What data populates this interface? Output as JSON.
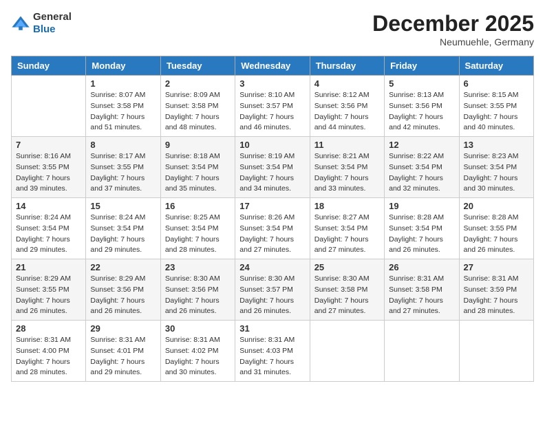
{
  "logo": {
    "general": "General",
    "blue": "Blue"
  },
  "header": {
    "month": "December 2025",
    "location": "Neumuehle, Germany"
  },
  "weekdays": [
    "Sunday",
    "Monday",
    "Tuesday",
    "Wednesday",
    "Thursday",
    "Friday",
    "Saturday"
  ],
  "weeks": [
    [
      {
        "day": "",
        "sunrise": "",
        "sunset": "",
        "daylight": ""
      },
      {
        "day": "1",
        "sunrise": "Sunrise: 8:07 AM",
        "sunset": "Sunset: 3:58 PM",
        "daylight": "Daylight: 7 hours and 51 minutes."
      },
      {
        "day": "2",
        "sunrise": "Sunrise: 8:09 AM",
        "sunset": "Sunset: 3:58 PM",
        "daylight": "Daylight: 7 hours and 48 minutes."
      },
      {
        "day": "3",
        "sunrise": "Sunrise: 8:10 AM",
        "sunset": "Sunset: 3:57 PM",
        "daylight": "Daylight: 7 hours and 46 minutes."
      },
      {
        "day": "4",
        "sunrise": "Sunrise: 8:12 AM",
        "sunset": "Sunset: 3:56 PM",
        "daylight": "Daylight: 7 hours and 44 minutes."
      },
      {
        "day": "5",
        "sunrise": "Sunrise: 8:13 AM",
        "sunset": "Sunset: 3:56 PM",
        "daylight": "Daylight: 7 hours and 42 minutes."
      },
      {
        "day": "6",
        "sunrise": "Sunrise: 8:15 AM",
        "sunset": "Sunset: 3:55 PM",
        "daylight": "Daylight: 7 hours and 40 minutes."
      }
    ],
    [
      {
        "day": "7",
        "sunrise": "Sunrise: 8:16 AM",
        "sunset": "Sunset: 3:55 PM",
        "daylight": "Daylight: 7 hours and 39 minutes."
      },
      {
        "day": "8",
        "sunrise": "Sunrise: 8:17 AM",
        "sunset": "Sunset: 3:55 PM",
        "daylight": "Daylight: 7 hours and 37 minutes."
      },
      {
        "day": "9",
        "sunrise": "Sunrise: 8:18 AM",
        "sunset": "Sunset: 3:54 PM",
        "daylight": "Daylight: 7 hours and 35 minutes."
      },
      {
        "day": "10",
        "sunrise": "Sunrise: 8:19 AM",
        "sunset": "Sunset: 3:54 PM",
        "daylight": "Daylight: 7 hours and 34 minutes."
      },
      {
        "day": "11",
        "sunrise": "Sunrise: 8:21 AM",
        "sunset": "Sunset: 3:54 PM",
        "daylight": "Daylight: 7 hours and 33 minutes."
      },
      {
        "day": "12",
        "sunrise": "Sunrise: 8:22 AM",
        "sunset": "Sunset: 3:54 PM",
        "daylight": "Daylight: 7 hours and 32 minutes."
      },
      {
        "day": "13",
        "sunrise": "Sunrise: 8:23 AM",
        "sunset": "Sunset: 3:54 PM",
        "daylight": "Daylight: 7 hours and 30 minutes."
      }
    ],
    [
      {
        "day": "14",
        "sunrise": "Sunrise: 8:24 AM",
        "sunset": "Sunset: 3:54 PM",
        "daylight": "Daylight: 7 hours and 29 minutes."
      },
      {
        "day": "15",
        "sunrise": "Sunrise: 8:24 AM",
        "sunset": "Sunset: 3:54 PM",
        "daylight": "Daylight: 7 hours and 29 minutes."
      },
      {
        "day": "16",
        "sunrise": "Sunrise: 8:25 AM",
        "sunset": "Sunset: 3:54 PM",
        "daylight": "Daylight: 7 hours and 28 minutes."
      },
      {
        "day": "17",
        "sunrise": "Sunrise: 8:26 AM",
        "sunset": "Sunset: 3:54 PM",
        "daylight": "Daylight: 7 hours and 27 minutes."
      },
      {
        "day": "18",
        "sunrise": "Sunrise: 8:27 AM",
        "sunset": "Sunset: 3:54 PM",
        "daylight": "Daylight: 7 hours and 27 minutes."
      },
      {
        "day": "19",
        "sunrise": "Sunrise: 8:28 AM",
        "sunset": "Sunset: 3:54 PM",
        "daylight": "Daylight: 7 hours and 26 minutes."
      },
      {
        "day": "20",
        "sunrise": "Sunrise: 8:28 AM",
        "sunset": "Sunset: 3:55 PM",
        "daylight": "Daylight: 7 hours and 26 minutes."
      }
    ],
    [
      {
        "day": "21",
        "sunrise": "Sunrise: 8:29 AM",
        "sunset": "Sunset: 3:55 PM",
        "daylight": "Daylight: 7 hours and 26 minutes."
      },
      {
        "day": "22",
        "sunrise": "Sunrise: 8:29 AM",
        "sunset": "Sunset: 3:56 PM",
        "daylight": "Daylight: 7 hours and 26 minutes."
      },
      {
        "day": "23",
        "sunrise": "Sunrise: 8:30 AM",
        "sunset": "Sunset: 3:56 PM",
        "daylight": "Daylight: 7 hours and 26 minutes."
      },
      {
        "day": "24",
        "sunrise": "Sunrise: 8:30 AM",
        "sunset": "Sunset: 3:57 PM",
        "daylight": "Daylight: 7 hours and 26 minutes."
      },
      {
        "day": "25",
        "sunrise": "Sunrise: 8:30 AM",
        "sunset": "Sunset: 3:58 PM",
        "daylight": "Daylight: 7 hours and 27 minutes."
      },
      {
        "day": "26",
        "sunrise": "Sunrise: 8:31 AM",
        "sunset": "Sunset: 3:58 PM",
        "daylight": "Daylight: 7 hours and 27 minutes."
      },
      {
        "day": "27",
        "sunrise": "Sunrise: 8:31 AM",
        "sunset": "Sunset: 3:59 PM",
        "daylight": "Daylight: 7 hours and 28 minutes."
      }
    ],
    [
      {
        "day": "28",
        "sunrise": "Sunrise: 8:31 AM",
        "sunset": "Sunset: 4:00 PM",
        "daylight": "Daylight: 7 hours and 28 minutes."
      },
      {
        "day": "29",
        "sunrise": "Sunrise: 8:31 AM",
        "sunset": "Sunset: 4:01 PM",
        "daylight": "Daylight: 7 hours and 29 minutes."
      },
      {
        "day": "30",
        "sunrise": "Sunrise: 8:31 AM",
        "sunset": "Sunset: 4:02 PM",
        "daylight": "Daylight: 7 hours and 30 minutes."
      },
      {
        "day": "31",
        "sunrise": "Sunrise: 8:31 AM",
        "sunset": "Sunset: 4:03 PM",
        "daylight": "Daylight: 7 hours and 31 minutes."
      },
      {
        "day": "",
        "sunrise": "",
        "sunset": "",
        "daylight": ""
      },
      {
        "day": "",
        "sunrise": "",
        "sunset": "",
        "daylight": ""
      },
      {
        "day": "",
        "sunrise": "",
        "sunset": "",
        "daylight": ""
      }
    ]
  ]
}
